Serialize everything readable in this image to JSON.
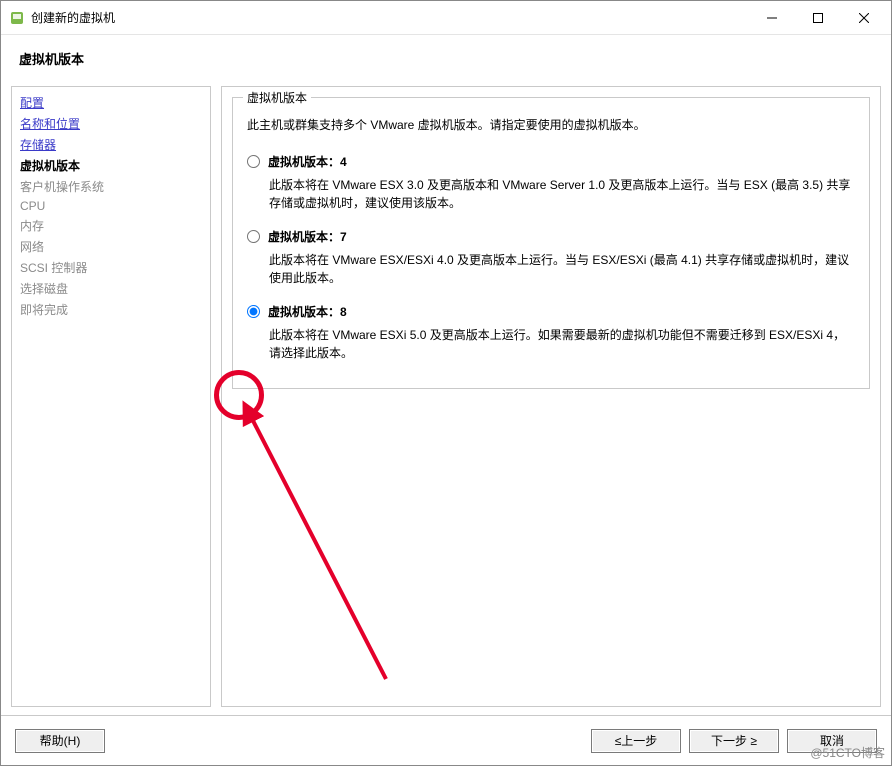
{
  "window": {
    "title": "创建新的虚拟机"
  },
  "header": {
    "title": "虚拟机版本"
  },
  "sidebar": {
    "items": [
      {
        "label": "配置",
        "kind": "link"
      },
      {
        "label": "名称和位置",
        "kind": "link"
      },
      {
        "label": "存储器",
        "kind": "link"
      },
      {
        "label": "虚拟机版本",
        "kind": "current"
      },
      {
        "label": "客户机操作系统",
        "kind": "disabled"
      },
      {
        "label": "CPU",
        "kind": "disabled"
      },
      {
        "label": "内存",
        "kind": "disabled"
      },
      {
        "label": "网络",
        "kind": "disabled"
      },
      {
        "label": "SCSI 控制器",
        "kind": "disabled"
      },
      {
        "label": "选择磁盘",
        "kind": "disabled"
      },
      {
        "label": "即将完成",
        "kind": "disabled"
      }
    ]
  },
  "fieldset": {
    "legend": "虚拟机版本",
    "desc": "此主机或群集支持多个 VMware 虚拟机版本。请指定要使用的虚拟机版本。",
    "options": [
      {
        "label": "虚拟机版本：4",
        "text": "此版本将在 VMware ESX 3.0 及更高版本和 VMware Server 1.0 及更高版本上运行。当与 ESX (最高 3.5) 共享存储或虚拟机时，建议使用该版本。",
        "selected": false
      },
      {
        "label": "虚拟机版本：7",
        "text": "此版本将在 VMware ESX/ESXi 4.0 及更高版本上运行。当与 ESX/ESXi (最高 4.1) 共享存储或虚拟机时，建议使用此版本。",
        "selected": false
      },
      {
        "label": "虚拟机版本：8",
        "text": "此版本将在 VMware ESXi 5.0 及更高版本上运行。如果需要最新的虚拟机功能但不需要迁移到 ESX/ESXi 4，请选择此版本。",
        "selected": true
      }
    ]
  },
  "footer": {
    "help": "帮助(H)",
    "back": "≤上一步",
    "next": "下一步 ≥",
    "cancel": "取消"
  },
  "watermark": "@51CTO博客"
}
